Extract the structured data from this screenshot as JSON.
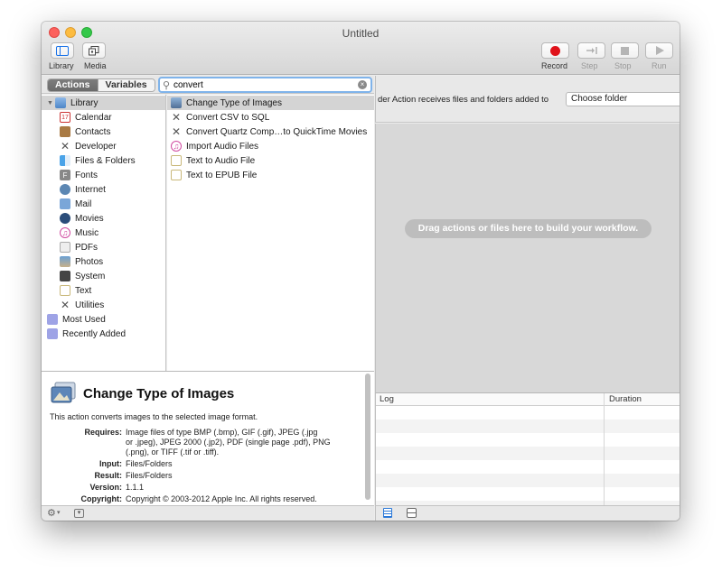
{
  "window": {
    "title": "Untitled"
  },
  "toolbar": {
    "library_label": "Library",
    "media_label": "Media",
    "record_label": "Record",
    "step_label": "Step",
    "stop_label": "Stop",
    "run_label": "Run"
  },
  "tabs": {
    "actions": "Actions",
    "variables": "Variables"
  },
  "search": {
    "value": "convert"
  },
  "library": {
    "root": "Library",
    "items": [
      "Calendar",
      "Contacts",
      "Developer",
      "Files & Folders",
      "Fonts",
      "Internet",
      "Mail",
      "Movies",
      "Music",
      "PDFs",
      "Photos",
      "System",
      "Text",
      "Utilities"
    ],
    "most_used": "Most Used",
    "recently_added": "Recently Added"
  },
  "actions": {
    "items": [
      "Change Type of Images",
      "Convert CSV to SQL",
      "Convert Quartz Comp…to QuickTime Movies",
      "Import Audio Files",
      "Text to Audio File",
      "Text to EPUB File"
    ]
  },
  "description": {
    "title": "Change Type of Images",
    "summary": "This action converts images to the selected image format.",
    "requires_label": "Requires:",
    "requires_line1": "Image files of type BMP (.bmp), GIF (.gif), JPEG (.jpg",
    "requires_line2": "or .jpeg), JPEG 2000 (.jp2), PDF (single page .pdf), PNG",
    "requires_line3": "(.png), or TIFF (.tif or .tiff).",
    "input_label": "Input:",
    "input_value": "Files/Folders",
    "result_label": "Result:",
    "result_value": "Files/Folders",
    "version_label": "Version:",
    "version_value": "1.1.1",
    "copyright_label": "Copyright:",
    "copyright_value": "Copyright © 2003-2012 Apple Inc.  All rights reserved."
  },
  "workflow": {
    "receives_text": "der Action receives files and folders added to",
    "choose_value": "Choose folder",
    "drag_hint": "Drag actions or files here to build your workflow."
  },
  "log": {
    "log_header": "Log",
    "duration_header": "Duration"
  },
  "colors": {
    "record_red": "#e0121a",
    "search_focus": "#7fb3ea"
  }
}
